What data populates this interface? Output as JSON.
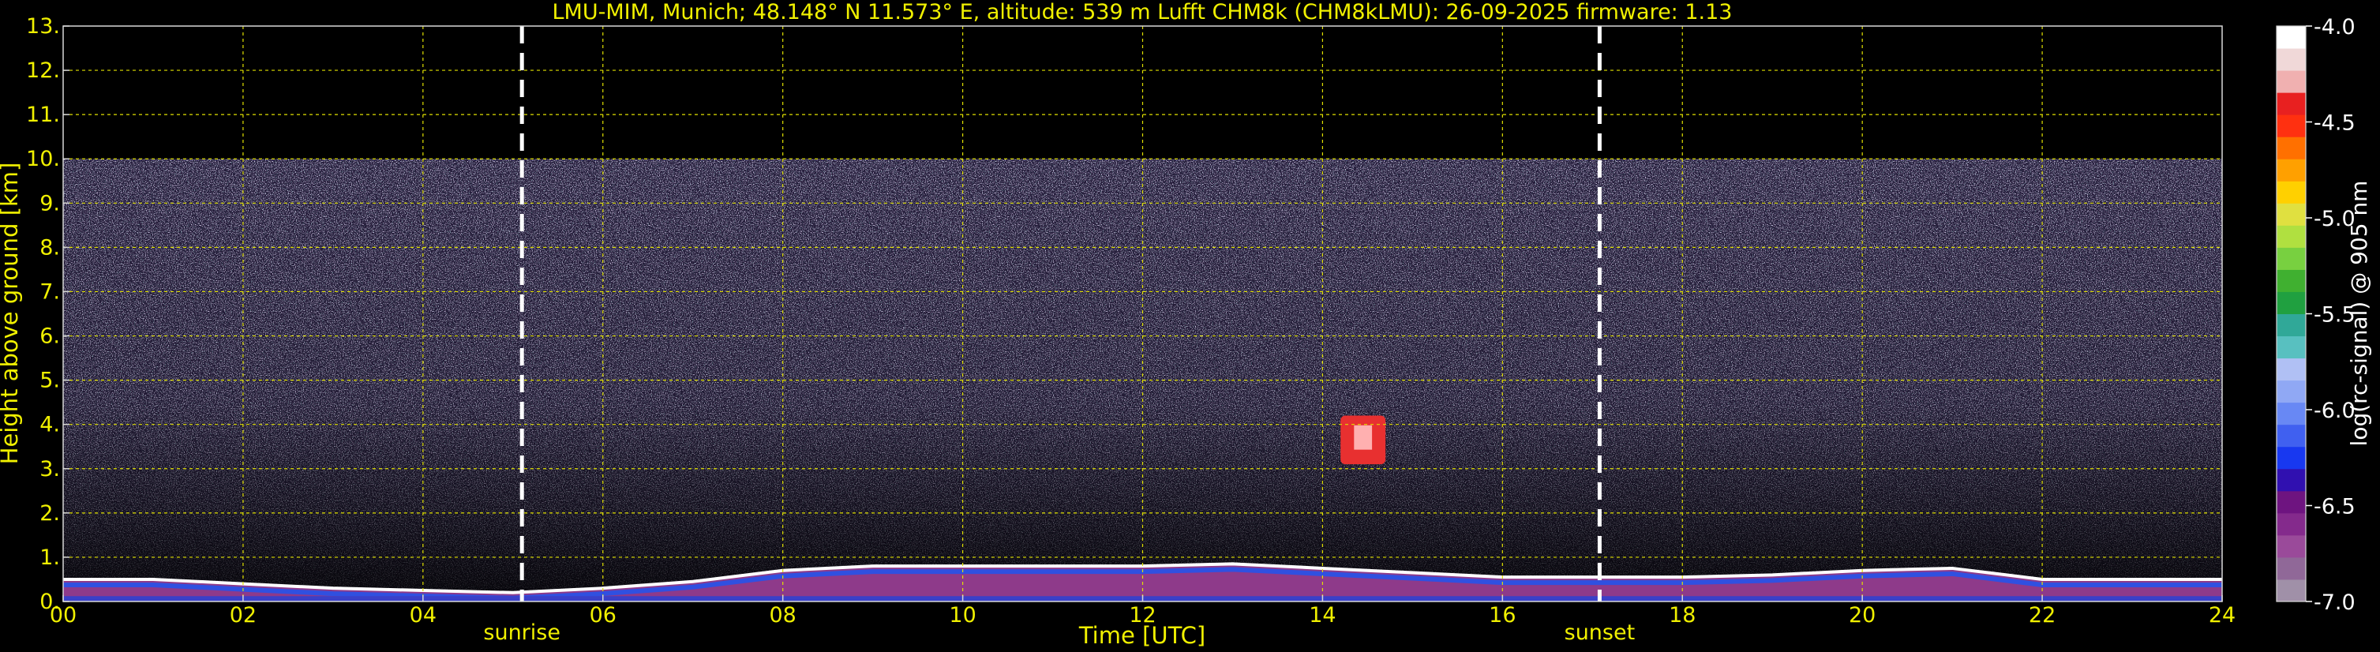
{
  "chart_data": {
    "type": "heatmap",
    "title": "LMU-MIM, Munich; 48.148° N 11.573° E, altitude: 539 m    Lufft CHM8k (CHM8kLMU): 26-09-2025    firmware: 1.13",
    "xlabel": "Time [UTC]",
    "ylabel": "Height above ground [km]",
    "xlim": [
      0,
      24
    ],
    "ylim": [
      0,
      13
    ],
    "x_tick_labels": [
      "00",
      "02",
      "04",
      "06",
      "08",
      "10",
      "12",
      "14",
      "16",
      "18",
      "20",
      "22",
      "24"
    ],
    "y_tick_labels": [
      "0.",
      "1.",
      "2.",
      "3.",
      "4.",
      "5.",
      "6.",
      "7.",
      "8.",
      "9.",
      "10.",
      "11.",
      "12.",
      "13."
    ],
    "grid": true,
    "data_top_km": 10,
    "markers": [
      {
        "label": "sunrise",
        "time": 5.1
      },
      {
        "label": "sunset",
        "time": 17.08
      }
    ],
    "colorbar": {
      "label": "log(rc-signal) @ 905 nm",
      "range": [
        -7.0,
        -4.0
      ],
      "tick_labels": [
        "-4.0",
        "-4.5",
        "-5.0",
        "-5.5",
        "-6.0",
        "-6.5",
        "-7.0"
      ],
      "colors": [
        "#a090a8",
        "#906898",
        "#9a4a9a",
        "#842a8c",
        "#6e1480",
        "#3010b0",
        "#1838f0",
        "#4060f0",
        "#6888f4",
        "#90a8f4",
        "#b0c0f4",
        "#58c0c0",
        "#30a898",
        "#20a040",
        "#40b030",
        "#78d040",
        "#b0e040",
        "#e0e040",
        "#ffd000",
        "#ffa000",
        "#ff7000",
        "#ff3010",
        "#e82020",
        "#f0b0b0",
        "#f0d8d8",
        "#ffffff"
      ]
    },
    "features": [
      {
        "label": "boundary-layer",
        "profile_times": [
          0,
          1,
          2,
          3,
          4,
          5,
          6,
          7,
          8,
          9,
          10,
          11,
          12,
          13,
          14,
          15,
          16,
          17,
          18,
          19,
          20,
          21,
          22,
          23,
          24
        ],
        "profile_height_km": [
          0.5,
          0.5,
          0.4,
          0.3,
          0.25,
          0.2,
          0.3,
          0.45,
          0.7,
          0.8,
          0.8,
          0.8,
          0.8,
          0.85,
          0.75,
          0.65,
          0.55,
          0.55,
          0.55,
          0.6,
          0.7,
          0.75,
          0.5,
          0.5,
          0.5
        ]
      },
      {
        "label": "cloud",
        "time_range": [
          14.2,
          14.7
        ],
        "height_range_km": [
          3.1,
          4.2
        ]
      }
    ]
  }
}
